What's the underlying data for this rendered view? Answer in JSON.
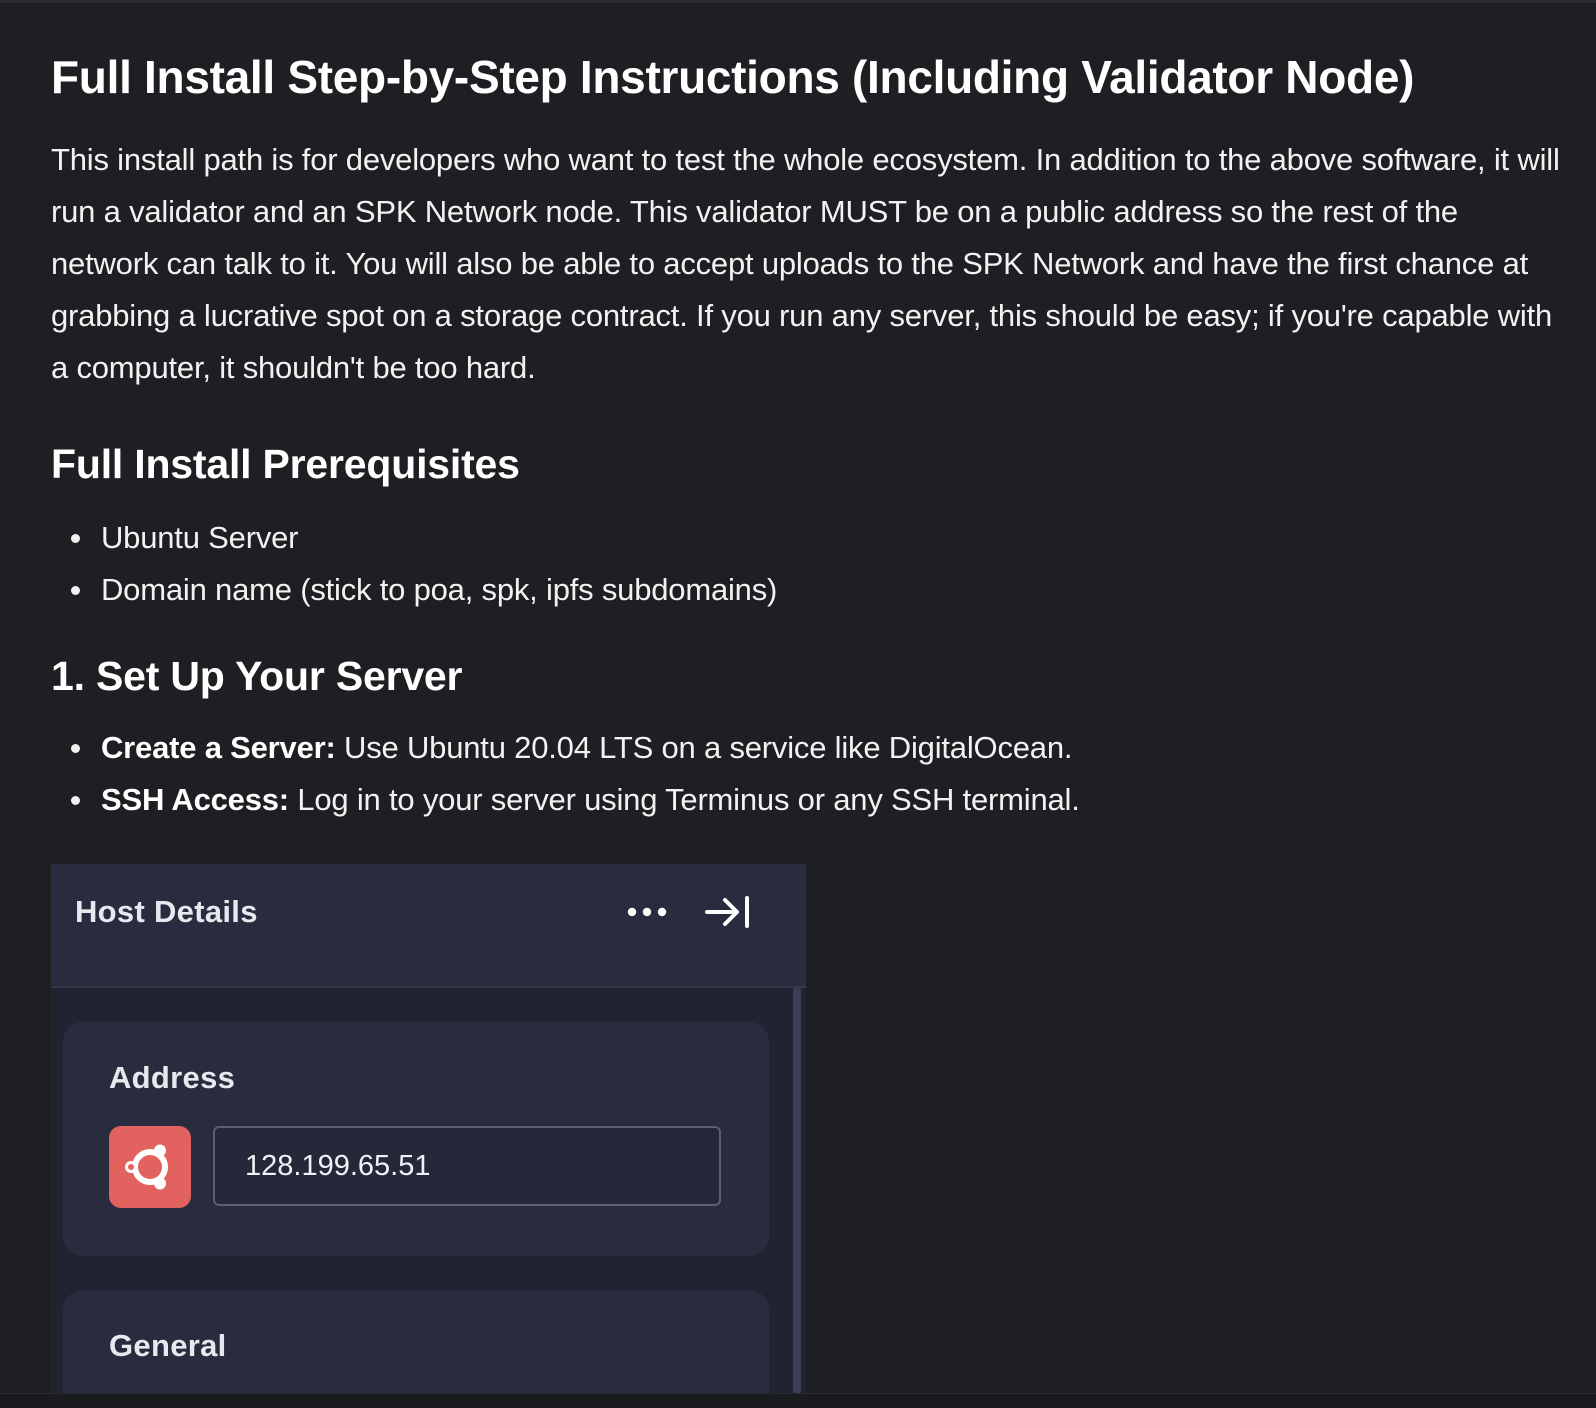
{
  "article": {
    "title": "Full Install Step-by-Step Instructions (Including Validator Node)",
    "intro": "This install path is for developers who want to test the whole ecosystem. In addition to the above software, it will run a validator and an SPK Network node. This validator MUST be on a public address so the rest of the network can talk to it. You will also be able to accept uploads to the SPK Network and have the first chance at grabbing a lucrative spot on a storage contract. If you run any server, this should be easy; if you're capable with a computer, it shouldn't be too hard.",
    "prereq_heading": "Full Install Prerequisites",
    "prereq_items": [
      "Ubuntu Server",
      "Domain name (stick to poa, spk, ipfs subdomains)"
    ],
    "setup_heading": "1. Set Up Your Server",
    "setup_items": [
      {
        "label": "Create a Server:",
        "text": " Use Ubuntu 20.04 LTS on a service like DigitalOcean."
      },
      {
        "label": "SSH Access:",
        "text": " Log in to your server using Terminus or any SSH terminal."
      }
    ]
  },
  "host_panel": {
    "title": "Host Details",
    "more_icon": "more-horizontal-icon",
    "collapse_icon": "arrow-right-to-bar-icon",
    "address_label": "Address",
    "os_icon": "ubuntu-logo-icon",
    "address_value": "128.199.65.51",
    "general_label": "General",
    "colors": {
      "header_bg": "#292c3e",
      "card_bg": "#282c3e",
      "os_icon_bg": "#e2625f"
    }
  }
}
